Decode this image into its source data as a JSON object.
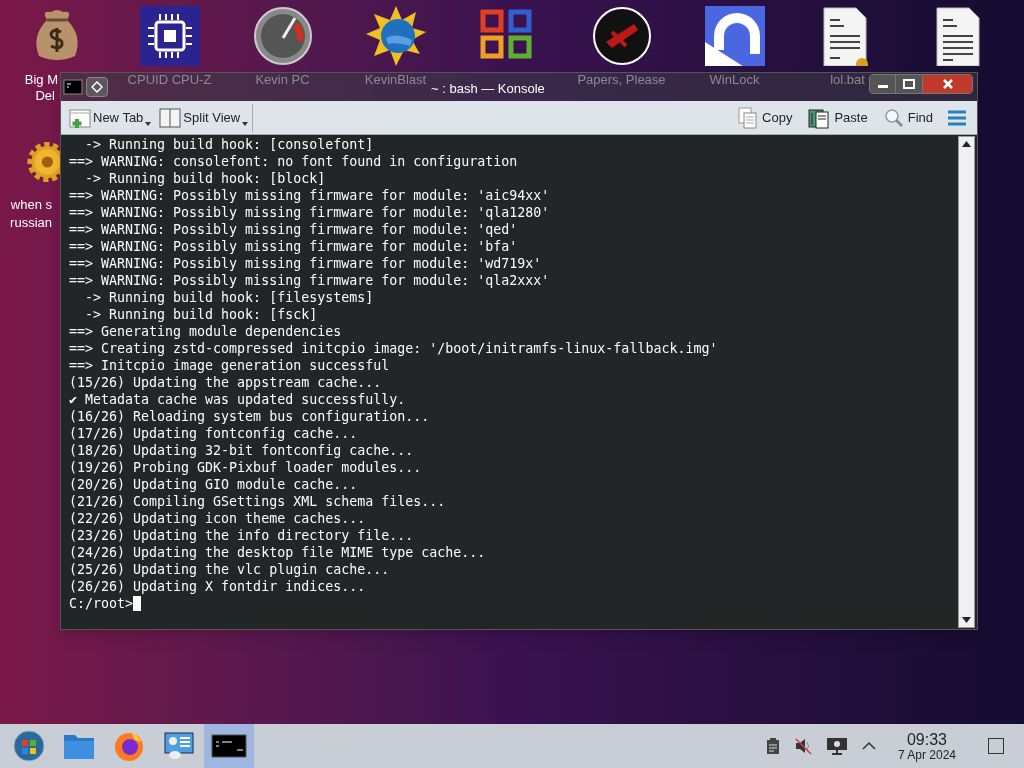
{
  "desktop_icons": [
    {
      "kind": "money",
      "lines": [
        "Big M",
        "Del"
      ]
    },
    {
      "kind": "chip",
      "lines": [
        "CPUID CPU-Z"
      ]
    },
    {
      "kind": "gauge",
      "lines": [
        "Kevin PC"
      ]
    },
    {
      "kind": "globe",
      "lines": [
        "KevinBlast"
      ]
    },
    {
      "kind": "office"
    },
    {
      "kind": "seal",
      "lines": [
        "Papers, Please"
      ]
    },
    {
      "kind": "lock",
      "lines": [
        "WinLock"
      ]
    },
    {
      "kind": "script",
      "lines": [
        "lol.bat"
      ]
    },
    {
      "kind": "doc"
    }
  ],
  "side_icons": [
    {
      "kind": "gear",
      "lines": [
        "when s",
        "russian"
      ]
    }
  ],
  "window": {
    "title": "~ : bash — Konsole",
    "toolbar": {
      "left": [
        {
          "kind": "newtab",
          "label": "New Tab"
        },
        {
          "kind": "split",
          "label": "Split View"
        }
      ],
      "right": [
        {
          "kind": "copy",
          "label": "Copy"
        },
        {
          "kind": "paste",
          "label": "Paste"
        },
        {
          "kind": "find",
          "label": "Find"
        }
      ]
    },
    "terminal": {
      "lines": [
        "  -> Running build hook: [consolefont]",
        "==> WARNING: consolefont: no font found in configuration",
        "  -> Running build hook: [block]",
        "==> WARNING: Possibly missing firmware for module: 'aic94xx'",
        "==> WARNING: Possibly missing firmware for module: 'qla1280'",
        "==> WARNING: Possibly missing firmware for module: 'qed'",
        "==> WARNING: Possibly missing firmware for module: 'bfa'",
        "==> WARNING: Possibly missing firmware for module: 'wd719x'",
        "==> WARNING: Possibly missing firmware for module: 'qla2xxx'",
        "  -> Running build hook: [filesystems]",
        "  -> Running build hook: [fsck]",
        "==> Generating module dependencies",
        "==> Creating zstd-compressed initcpio image: '/boot/initramfs-linux-fallback.img'",
        "==> Initcpio image generation successful",
        "(15/26) Updating the appstream cache...",
        "✔ Metadata cache was updated successfully.",
        "(16/26) Reloading system bus configuration...",
        "(17/26) Updating fontconfig cache...",
        "(18/26) Updating 32-bit fontconfig cache...",
        "(19/26) Probing GDK-Pixbuf loader modules...",
        "(20/26) Updating GIO module cache...",
        "(21/26) Compiling GSettings XML schema files...",
        "(22/26) Updating icon theme caches...",
        "(23/26) Updating the info directory file...",
        "(24/26) Updating the desktop file MIME type cache...",
        "(25/26) Updating the vlc plugin cache...",
        "(26/26) Updating X fontdir indices..."
      ],
      "prompt": "C:/root>"
    }
  },
  "taskbar": {
    "items": [
      {
        "kind": "start",
        "selected": false
      },
      {
        "kind": "folder",
        "selected": false
      },
      {
        "kind": "firefox",
        "selected": false
      },
      {
        "kind": "monitor",
        "selected": false
      },
      {
        "kind": "terminal",
        "selected": true
      }
    ],
    "tray": [
      {
        "kind": "clipboard"
      },
      {
        "kind": "muted"
      },
      {
        "kind": "display"
      },
      {
        "kind": "caret"
      }
    ],
    "time": "09:33",
    "date": "7 Apr 2024"
  }
}
